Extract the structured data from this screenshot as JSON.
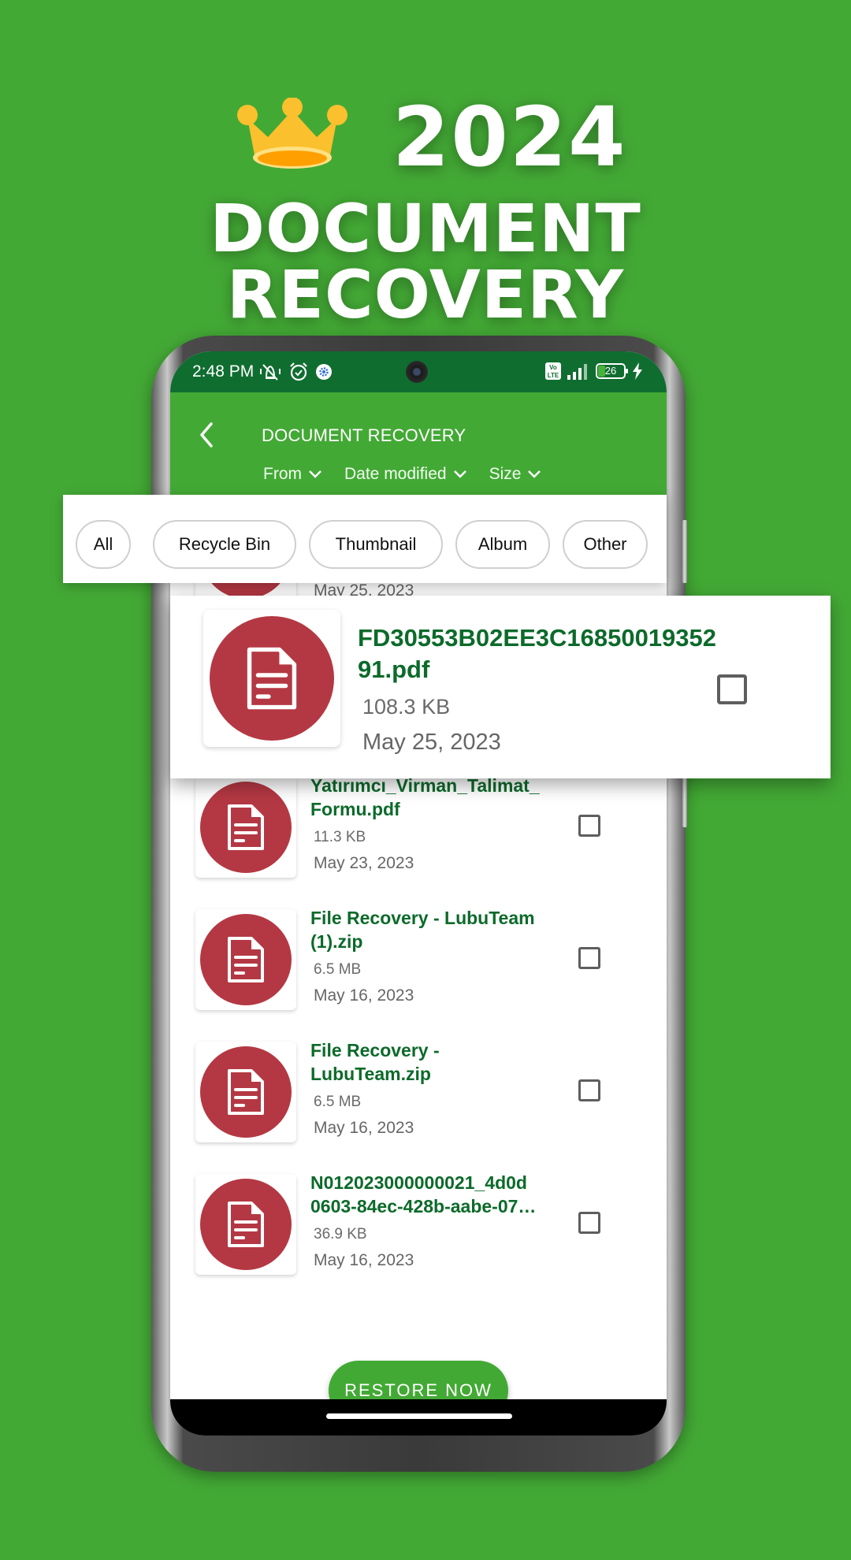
{
  "promo": {
    "year": "2024",
    "headline": "DOCUMENT RECOVERY",
    "crown_colors": {
      "body": "#fbc02d",
      "rim": "#ffe082",
      "inner": "#ffa000"
    }
  },
  "status_bar": {
    "time": "2:48 PM",
    "left_icons": [
      "mute-vibrate-icon",
      "alarm-icon",
      "settings-gear-icon"
    ],
    "right_icons": [
      "volte-icon",
      "signal-icon",
      "battery-icon",
      "charging-icon"
    ],
    "network_label": "Vo LTE",
    "battery_level": "26"
  },
  "app_bar": {
    "title": "DOCUMENT RECOVERY",
    "back_icon": "chevron-left-icon",
    "sort_options": [
      {
        "label": "From"
      },
      {
        "label": "Date modified"
      },
      {
        "label": "Size"
      }
    ]
  },
  "filters": {
    "chips": [
      {
        "label": "All"
      },
      {
        "label": "Recycle Bin"
      },
      {
        "label": "Thumbnail"
      },
      {
        "label": "Album"
      },
      {
        "label": "Other"
      }
    ]
  },
  "highlighted_file": {
    "name": "FD30553B02EE3C1685001935291.pdf",
    "size": "108.3 KB",
    "date": "May 25, 2023",
    "checked": false
  },
  "files": [
    {
      "name": "FD30553B02EE3C1685001935291.pdf",
      "size": "108.3 KB",
      "date": "May 25, 2023",
      "checked": false
    },
    {
      "name": "",
      "size": "11.3 KB",
      "date": "May 23, 2023",
      "checked": false
    },
    {
      "name": "Yatırımcı_Virman_Talimat_ Formu.pdf",
      "size": "11.3 KB",
      "date": "May 23, 2023",
      "checked": false
    },
    {
      "name": "File Recovery - LubuTeam (1).zip",
      "size": "6.5 MB",
      "date": "May 16, 2023",
      "checked": false
    },
    {
      "name": "File Recovery - LubuTeam.zip",
      "size": "6.5 MB",
      "date": "May 16, 2023",
      "checked": false
    },
    {
      "name": "N012023000000021_4d0d 0603-84ec-428b-aabe-07…",
      "size": "36.9 KB",
      "date": "May 16, 2023",
      "checked": false
    }
  ],
  "actions": {
    "restore_label": "RESTORE NOW"
  },
  "colors": {
    "background": "#43a935",
    "status_bar": "#106d30",
    "app_bar": "#43a935",
    "file_name": "#0c6a2a",
    "file_icon": "#b43843",
    "button": "#43a935"
  }
}
